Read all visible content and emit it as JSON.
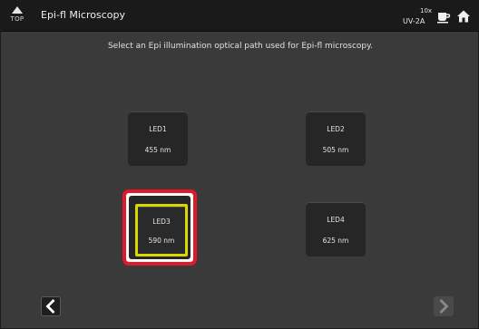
{
  "titlebar": {
    "top_label": "TOP",
    "title": "Epi-fl Microscopy",
    "magnification": "10x",
    "filter_cube": "UV-2A"
  },
  "instruction": "Select an Epi illumination optical path used for Epi-fl microscopy.",
  "leds": [
    {
      "name": "LED1",
      "wavelength": "455 nm",
      "selected": false
    },
    {
      "name": "LED2",
      "wavelength": "505 nm",
      "selected": false
    },
    {
      "name": "LED3",
      "wavelength": "590 nm",
      "selected": true
    },
    {
      "name": "LED4",
      "wavelength": "625 nm",
      "selected": false
    }
  ],
  "icons": {
    "top": "top-arrow-icon",
    "coffee": "coffee-cup-icon",
    "home": "home-icon",
    "prev": "chevron-left-icon",
    "next": "chevron-right-icon"
  },
  "colors": {
    "highlight_red": "#e0182a",
    "selection_yellow": "#d8d800"
  }
}
